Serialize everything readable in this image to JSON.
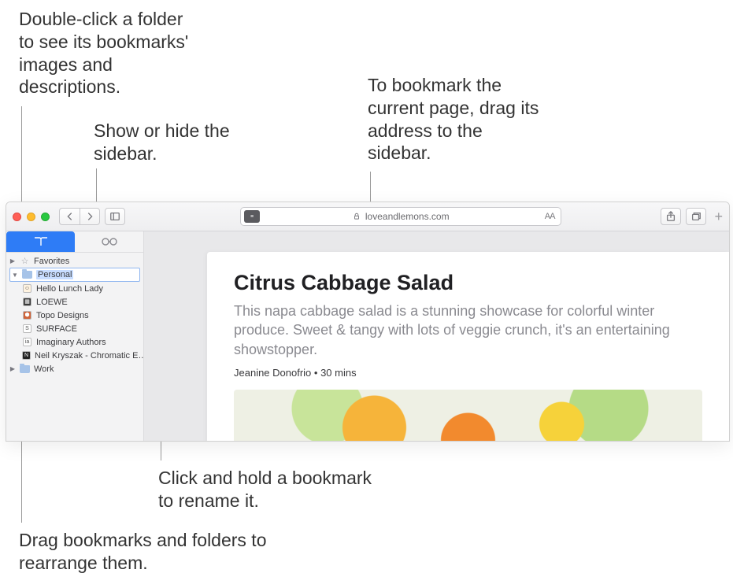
{
  "callouts": {
    "double_click": "Double-click a folder to see its bookmarks' images and descriptions.",
    "show_hide": "Show or hide the sidebar.",
    "bookmark_drag": "To bookmark the current page, drag its address to the sidebar.",
    "rename": "Click and hold a bookmark to rename it.",
    "rearrange": "Drag bookmarks and folders to rearrange them."
  },
  "toolbar": {
    "address": "loveandlemons.com",
    "reader_aa": "AA"
  },
  "sidebar": {
    "favorites_label": "Favorites",
    "personal_label": "Personal",
    "work_label": "Work",
    "items": [
      "Hello Lunch Lady",
      "LOEWE",
      "Topo Designs",
      "SURFACE",
      "Imaginary Authors",
      "Neil Kryszak - Chromatic E…"
    ]
  },
  "article": {
    "title": "Citrus Cabbage Salad",
    "description": "This napa cabbage salad is a stunning showcase for colorful winter produce. Sweet & tangy with lots of veggie crunch, it's an entertaining showstopper.",
    "author": "Jeanine Donofrio",
    "time": "30 mins",
    "byline_sep": "  •  "
  }
}
